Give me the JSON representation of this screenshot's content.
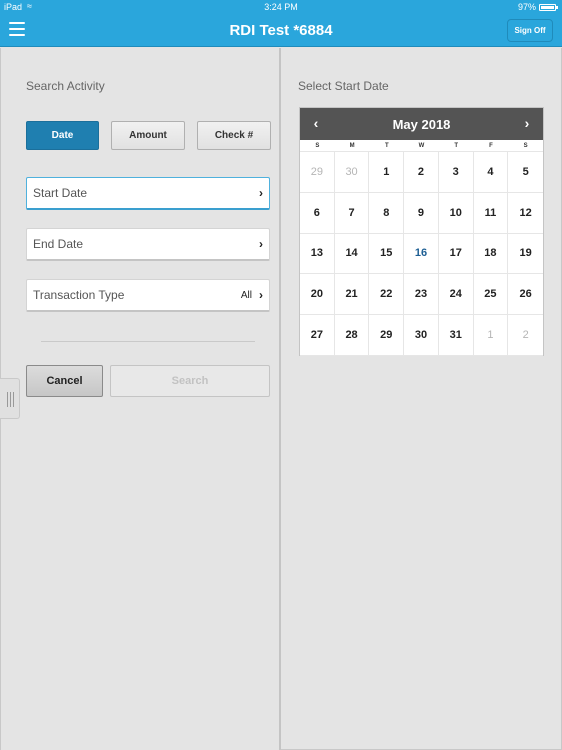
{
  "status_bar": {
    "carrier": "iPad",
    "wifi_icon": "wifi-icon",
    "time": "3:24 PM",
    "battery": "97%"
  },
  "header": {
    "menu_icon": "hamburger-menu-icon",
    "title": "RDI Test *6884",
    "sign_off": "Sign Off"
  },
  "search": {
    "section_label": "Search Activity",
    "modes": [
      {
        "label": "Date",
        "active": true
      },
      {
        "label": "Amount",
        "active": false
      },
      {
        "label": "Check #",
        "active": false
      }
    ],
    "fields": [
      {
        "label": "Start Date",
        "value": "",
        "chevron": "›"
      },
      {
        "label": "End Date",
        "value": "",
        "chevron": "›"
      },
      {
        "label": "Transaction Type",
        "value": "All",
        "chevron": "›"
      }
    ],
    "cancel_label": "Cancel",
    "search_label": "Search"
  },
  "calendar": {
    "section_label": "Select Start Date",
    "month_label": "May 2018",
    "prev": "‹",
    "next": "›",
    "weekdays": [
      "S",
      "M",
      "T",
      "W",
      "T",
      "F",
      "S"
    ],
    "highlighted_day": "16",
    "days": [
      {
        "d": "29",
        "other": true
      },
      {
        "d": "30",
        "other": true
      },
      {
        "d": "1"
      },
      {
        "d": "2"
      },
      {
        "d": "3"
      },
      {
        "d": "4"
      },
      {
        "d": "5"
      },
      {
        "d": "6"
      },
      {
        "d": "7"
      },
      {
        "d": "8"
      },
      {
        "d": "9"
      },
      {
        "d": "10"
      },
      {
        "d": "11"
      },
      {
        "d": "12"
      },
      {
        "d": "13"
      },
      {
        "d": "14"
      },
      {
        "d": "15"
      },
      {
        "d": "16",
        "today": true
      },
      {
        "d": "17"
      },
      {
        "d": "18"
      },
      {
        "d": "19"
      },
      {
        "d": "20"
      },
      {
        "d": "21"
      },
      {
        "d": "22"
      },
      {
        "d": "23"
      },
      {
        "d": "24"
      },
      {
        "d": "25"
      },
      {
        "d": "26"
      },
      {
        "d": "27"
      },
      {
        "d": "28"
      },
      {
        "d": "29"
      },
      {
        "d": "30"
      },
      {
        "d": "31"
      },
      {
        "d": "1",
        "other": true
      },
      {
        "d": "2",
        "other": true
      }
    ]
  },
  "colors": {
    "header_bg": "#2aa6dc",
    "active_tab": "#1f7fb0",
    "calendar_header": "#545454",
    "today_text": "#1e5f94"
  }
}
